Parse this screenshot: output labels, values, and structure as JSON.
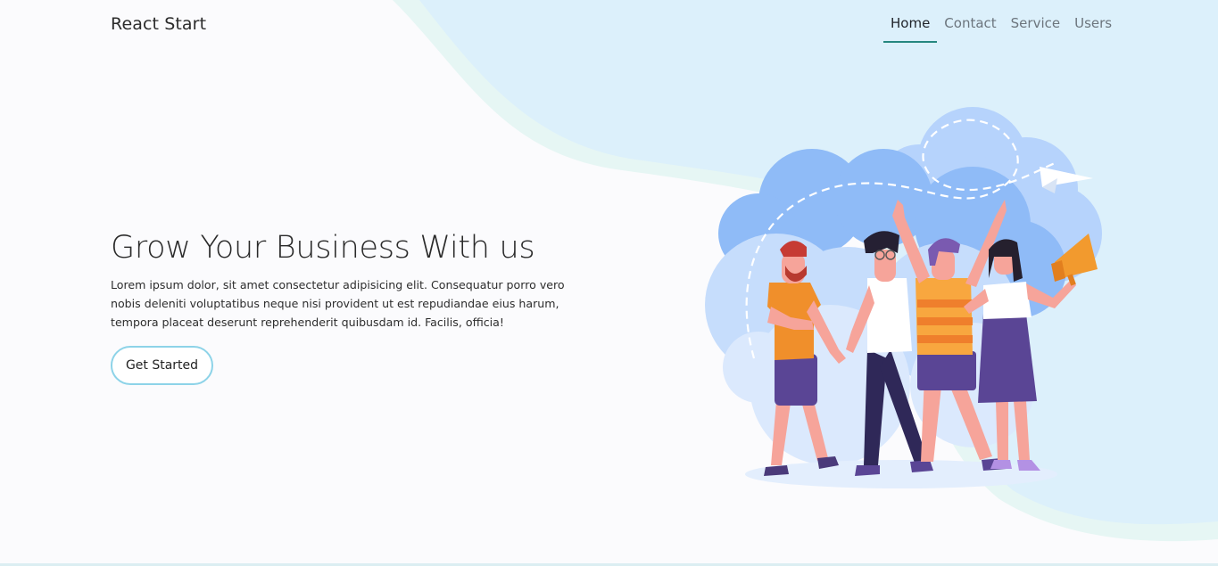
{
  "navbar": {
    "brand": "React Start",
    "items": [
      {
        "label": "Home",
        "active": true
      },
      {
        "label": "Contact",
        "active": false
      },
      {
        "label": "Service",
        "active": false
      },
      {
        "label": "Users",
        "active": false
      }
    ]
  },
  "hero": {
    "title": "Grow Your Business With us",
    "description": "Lorem ipsum dolor, sit amet consectetur adipisicing elit. Consequatur porro vero nobis deleniti voluptatibus neque nisi provident ut est repudiandae eius harum, tempora placeat deserunt reprehenderit quibusdam id. Facilis, officia!",
    "button_label": "Get Started"
  },
  "colors": {
    "accent": "#26877f",
    "button_border": "#8dd3e8",
    "background_wave": "#dcf0fb",
    "cloud": "#a7c8fb"
  }
}
